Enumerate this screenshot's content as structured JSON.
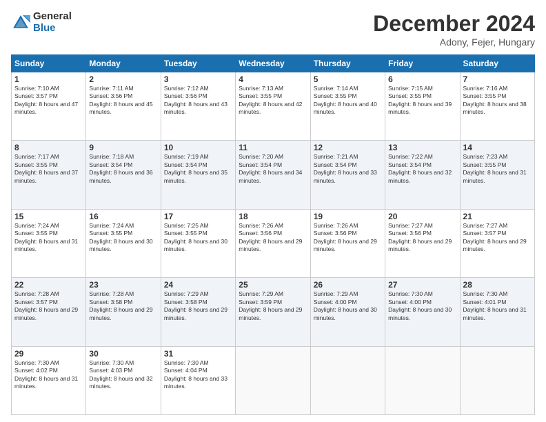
{
  "header": {
    "logo_general": "General",
    "logo_blue": "Blue",
    "month_title": "December 2024",
    "location": "Adony, Fejer, Hungary"
  },
  "calendar": {
    "days_of_week": [
      "Sunday",
      "Monday",
      "Tuesday",
      "Wednesday",
      "Thursday",
      "Friday",
      "Saturday"
    ],
    "weeks": [
      [
        {
          "day": "1",
          "sunrise": "Sunrise: 7:10 AM",
          "sunset": "Sunset: 3:57 PM",
          "daylight": "Daylight: 8 hours and 47 minutes."
        },
        {
          "day": "2",
          "sunrise": "Sunrise: 7:11 AM",
          "sunset": "Sunset: 3:56 PM",
          "daylight": "Daylight: 8 hours and 45 minutes."
        },
        {
          "day": "3",
          "sunrise": "Sunrise: 7:12 AM",
          "sunset": "Sunset: 3:56 PM",
          "daylight": "Daylight: 8 hours and 43 minutes."
        },
        {
          "day": "4",
          "sunrise": "Sunrise: 7:13 AM",
          "sunset": "Sunset: 3:55 PM",
          "daylight": "Daylight: 8 hours and 42 minutes."
        },
        {
          "day": "5",
          "sunrise": "Sunrise: 7:14 AM",
          "sunset": "Sunset: 3:55 PM",
          "daylight": "Daylight: 8 hours and 40 minutes."
        },
        {
          "day": "6",
          "sunrise": "Sunrise: 7:15 AM",
          "sunset": "Sunset: 3:55 PM",
          "daylight": "Daylight: 8 hours and 39 minutes."
        },
        {
          "day": "7",
          "sunrise": "Sunrise: 7:16 AM",
          "sunset": "Sunset: 3:55 PM",
          "daylight": "Daylight: 8 hours and 38 minutes."
        }
      ],
      [
        {
          "day": "8",
          "sunrise": "Sunrise: 7:17 AM",
          "sunset": "Sunset: 3:55 PM",
          "daylight": "Daylight: 8 hours and 37 minutes."
        },
        {
          "day": "9",
          "sunrise": "Sunrise: 7:18 AM",
          "sunset": "Sunset: 3:54 PM",
          "daylight": "Daylight: 8 hours and 36 minutes."
        },
        {
          "day": "10",
          "sunrise": "Sunrise: 7:19 AM",
          "sunset": "Sunset: 3:54 PM",
          "daylight": "Daylight: 8 hours and 35 minutes."
        },
        {
          "day": "11",
          "sunrise": "Sunrise: 7:20 AM",
          "sunset": "Sunset: 3:54 PM",
          "daylight": "Daylight: 8 hours and 34 minutes."
        },
        {
          "day": "12",
          "sunrise": "Sunrise: 7:21 AM",
          "sunset": "Sunset: 3:54 PM",
          "daylight": "Daylight: 8 hours and 33 minutes."
        },
        {
          "day": "13",
          "sunrise": "Sunrise: 7:22 AM",
          "sunset": "Sunset: 3:54 PM",
          "daylight": "Daylight: 8 hours and 32 minutes."
        },
        {
          "day": "14",
          "sunrise": "Sunrise: 7:23 AM",
          "sunset": "Sunset: 3:55 PM",
          "daylight": "Daylight: 8 hours and 31 minutes."
        }
      ],
      [
        {
          "day": "15",
          "sunrise": "Sunrise: 7:24 AM",
          "sunset": "Sunset: 3:55 PM",
          "daylight": "Daylight: 8 hours and 31 minutes."
        },
        {
          "day": "16",
          "sunrise": "Sunrise: 7:24 AM",
          "sunset": "Sunset: 3:55 PM",
          "daylight": "Daylight: 8 hours and 30 minutes."
        },
        {
          "day": "17",
          "sunrise": "Sunrise: 7:25 AM",
          "sunset": "Sunset: 3:55 PM",
          "daylight": "Daylight: 8 hours and 30 minutes."
        },
        {
          "day": "18",
          "sunrise": "Sunrise: 7:26 AM",
          "sunset": "Sunset: 3:56 PM",
          "daylight": "Daylight: 8 hours and 29 minutes."
        },
        {
          "day": "19",
          "sunrise": "Sunrise: 7:26 AM",
          "sunset": "Sunset: 3:56 PM",
          "daylight": "Daylight: 8 hours and 29 minutes."
        },
        {
          "day": "20",
          "sunrise": "Sunrise: 7:27 AM",
          "sunset": "Sunset: 3:56 PM",
          "daylight": "Daylight: 8 hours and 29 minutes."
        },
        {
          "day": "21",
          "sunrise": "Sunrise: 7:27 AM",
          "sunset": "Sunset: 3:57 PM",
          "daylight": "Daylight: 8 hours and 29 minutes."
        }
      ],
      [
        {
          "day": "22",
          "sunrise": "Sunrise: 7:28 AM",
          "sunset": "Sunset: 3:57 PM",
          "daylight": "Daylight: 8 hours and 29 minutes."
        },
        {
          "day": "23",
          "sunrise": "Sunrise: 7:28 AM",
          "sunset": "Sunset: 3:58 PM",
          "daylight": "Daylight: 8 hours and 29 minutes."
        },
        {
          "day": "24",
          "sunrise": "Sunrise: 7:29 AM",
          "sunset": "Sunset: 3:58 PM",
          "daylight": "Daylight: 8 hours and 29 minutes."
        },
        {
          "day": "25",
          "sunrise": "Sunrise: 7:29 AM",
          "sunset": "Sunset: 3:59 PM",
          "daylight": "Daylight: 8 hours and 29 minutes."
        },
        {
          "day": "26",
          "sunrise": "Sunrise: 7:29 AM",
          "sunset": "Sunset: 4:00 PM",
          "daylight": "Daylight: 8 hours and 30 minutes."
        },
        {
          "day": "27",
          "sunrise": "Sunrise: 7:30 AM",
          "sunset": "Sunset: 4:00 PM",
          "daylight": "Daylight: 8 hours and 30 minutes."
        },
        {
          "day": "28",
          "sunrise": "Sunrise: 7:30 AM",
          "sunset": "Sunset: 4:01 PM",
          "daylight": "Daylight: 8 hours and 31 minutes."
        }
      ],
      [
        {
          "day": "29",
          "sunrise": "Sunrise: 7:30 AM",
          "sunset": "Sunset: 4:02 PM",
          "daylight": "Daylight: 8 hours and 31 minutes."
        },
        {
          "day": "30",
          "sunrise": "Sunrise: 7:30 AM",
          "sunset": "Sunset: 4:03 PM",
          "daylight": "Daylight: 8 hours and 32 minutes."
        },
        {
          "day": "31",
          "sunrise": "Sunrise: 7:30 AM",
          "sunset": "Sunset: 4:04 PM",
          "daylight": "Daylight: 8 hours and 33 minutes."
        },
        null,
        null,
        null,
        null
      ]
    ]
  }
}
